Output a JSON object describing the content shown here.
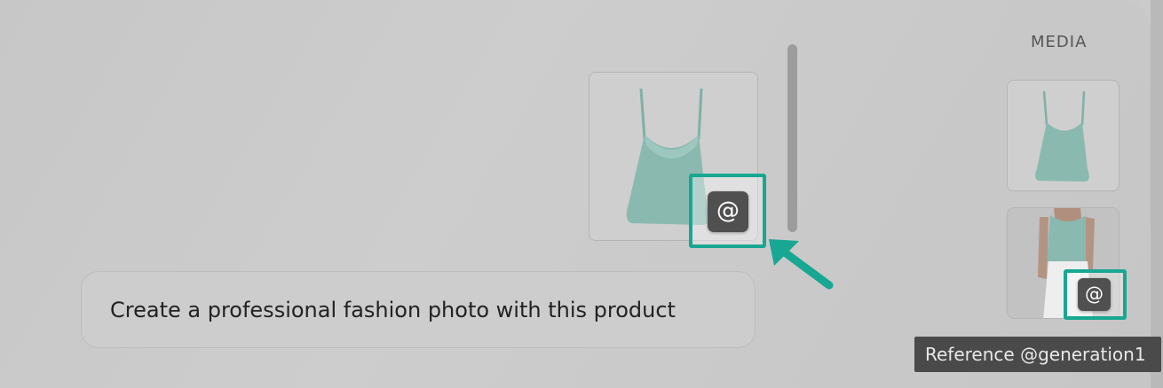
{
  "chat": {
    "prompt_text": "Create a professional fashion photo with this product",
    "attachment_reference_symbol": "@"
  },
  "media": {
    "title": "MEDIA",
    "items": [
      {
        "type": "product-image",
        "subject": "mint camisole"
      },
      {
        "type": "model-image",
        "subject": "model wearing mint camisole",
        "reference_symbol": "@"
      }
    ],
    "tooltip": "Reference @generation1"
  },
  "colors": {
    "highlight": "#17a792",
    "garment": "#8ab9b0",
    "button": "#505050"
  },
  "icons": [
    "at-icon",
    "arrow-pointer"
  ]
}
